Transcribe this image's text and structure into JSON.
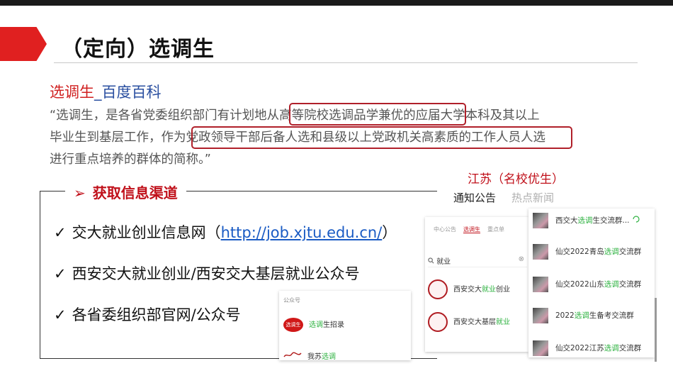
{
  "slide": {
    "title": "（定向）选调生",
    "baike_prefix": "选调生",
    "baike_suffix": "_百度百科",
    "quote_lines": [
      "“选调生，是各省党委组织部门有计划地从高等院校选调品学兼优的应届大学本科及其以上",
      "毕业生到基层工作，作为党政领导干部后备人选和县级以上党政机关高素质的工作人员人选",
      "进行重点培养的群体的简称。”"
    ]
  },
  "channels": {
    "arrow": "➢",
    "heading": "获取信息渠道",
    "check": "✓",
    "items": [
      {
        "text": "交大就业创业信息网（",
        "link": "http://job.xjtu.edu.cn/",
        "suffix": "）"
      },
      {
        "text": "西安交大就业创业/西安交大基层就业公众号"
      },
      {
        "text": "各省委组织部官网/公众号"
      }
    ]
  },
  "jiangsu": {
    "title": "江苏（名校优生）",
    "tabs": [
      "通知公告",
      "热点新闻"
    ]
  },
  "wechat_search": {
    "mini_tabs": [
      "中心公告",
      "选调生",
      "重点单"
    ],
    "query": "就业",
    "clear_icon": "⊗",
    "accounts": [
      {
        "prefix": "西安交大",
        "highlight": "就业",
        "suffix": "创业"
      },
      {
        "prefix": "西安交大基层",
        "highlight": "就业",
        "suffix": ""
      }
    ]
  },
  "groups": [
    {
      "prefix": "西交大",
      "highlight": "选调",
      "suffix": "生交流群..."
    },
    {
      "prefix": "仙交2022青岛",
      "highlight": "选调",
      "suffix": "交流群"
    },
    {
      "prefix": "仙交2022山东",
      "highlight": "选调",
      "suffix": "交流群"
    },
    {
      "prefix": "2022",
      "highlight": "选调",
      "suffix": "生备考交流群"
    },
    {
      "prefix": "仙交2022江苏",
      "highlight": "选调",
      "suffix": "交流群"
    }
  ],
  "gzh": {
    "header": "公众号",
    "logo_text": "选调生",
    "rows": [
      {
        "highlight": "选调",
        "suffix": "生招录"
      },
      {
        "prefix": "我苏",
        "highlight": "选调"
      }
    ]
  },
  "colors": {
    "accent_red": "#e02020",
    "link_blue": "#1a5bc4",
    "wechat_green": "#2db240"
  }
}
